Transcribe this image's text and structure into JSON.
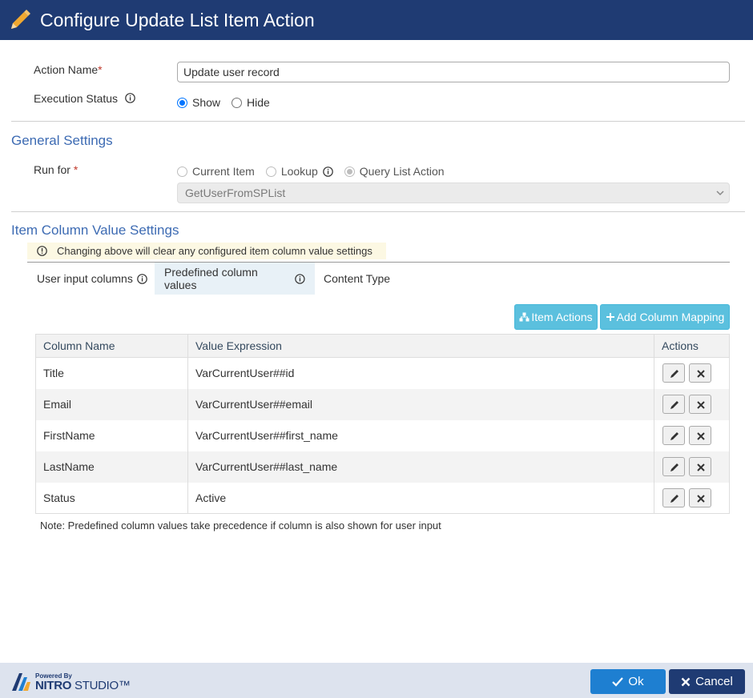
{
  "dialog": {
    "title": "Configure Update List Item Action"
  },
  "action_name": {
    "label": "Action Name",
    "required_mark": "*",
    "value": "Update user record"
  },
  "execution_status": {
    "label": "Execution Status",
    "options": [
      "Show",
      "Hide"
    ],
    "selected": "Show"
  },
  "general_settings": {
    "title": "General Settings",
    "run_for": {
      "label": "Run for",
      "required_mark": "*",
      "options": [
        "Current Item",
        "Lookup",
        "Query List Action"
      ],
      "selected": "Query List Action",
      "select_value": "GetUserFromSPList"
    }
  },
  "item_column_settings": {
    "title": "Item Column Value Settings",
    "warning": "Changing above will clear any configured item column value settings",
    "tabs": [
      {
        "label": "User input columns"
      },
      {
        "label": "Predefined column values"
      },
      {
        "label": "Content Type"
      }
    ],
    "active_tab": "Predefined column values",
    "buttons": {
      "item_actions": "Item Actions",
      "add_mapping": "Add Column Mapping"
    },
    "table": {
      "headers": [
        "Column Name",
        "Value Expression",
        "Actions"
      ],
      "rows": [
        {
          "column": "Title",
          "value": "VarCurrentUser##id"
        },
        {
          "column": "Email",
          "value": "VarCurrentUser##email"
        },
        {
          "column": "FirstName",
          "value": "VarCurrentUser##first_name"
        },
        {
          "column": "LastName",
          "value": "VarCurrentUser##last_name"
        },
        {
          "column": "Status",
          "value": "Active"
        }
      ]
    },
    "note": "Note: Predefined column values take precedence if column is also shown for user input"
  },
  "footer": {
    "logo": {
      "powered_by": "Powered By",
      "brand_strong": "NITRO",
      "brand_rest": "STUDIO™"
    },
    "ok_label": "Ok",
    "cancel_label": "Cancel"
  },
  "colors": {
    "header": "#1f3b73",
    "section": "#3d6bb3",
    "info_button": "#5bc0de",
    "ok": "#1e7fd1",
    "cancel": "#1f3b73"
  },
  "icons": [
    "pencil-icon",
    "info-icon",
    "warning-icon",
    "sitemap-icon",
    "plus-icon",
    "edit-icon",
    "close-icon",
    "check-icon",
    "chevron-down-icon"
  ]
}
